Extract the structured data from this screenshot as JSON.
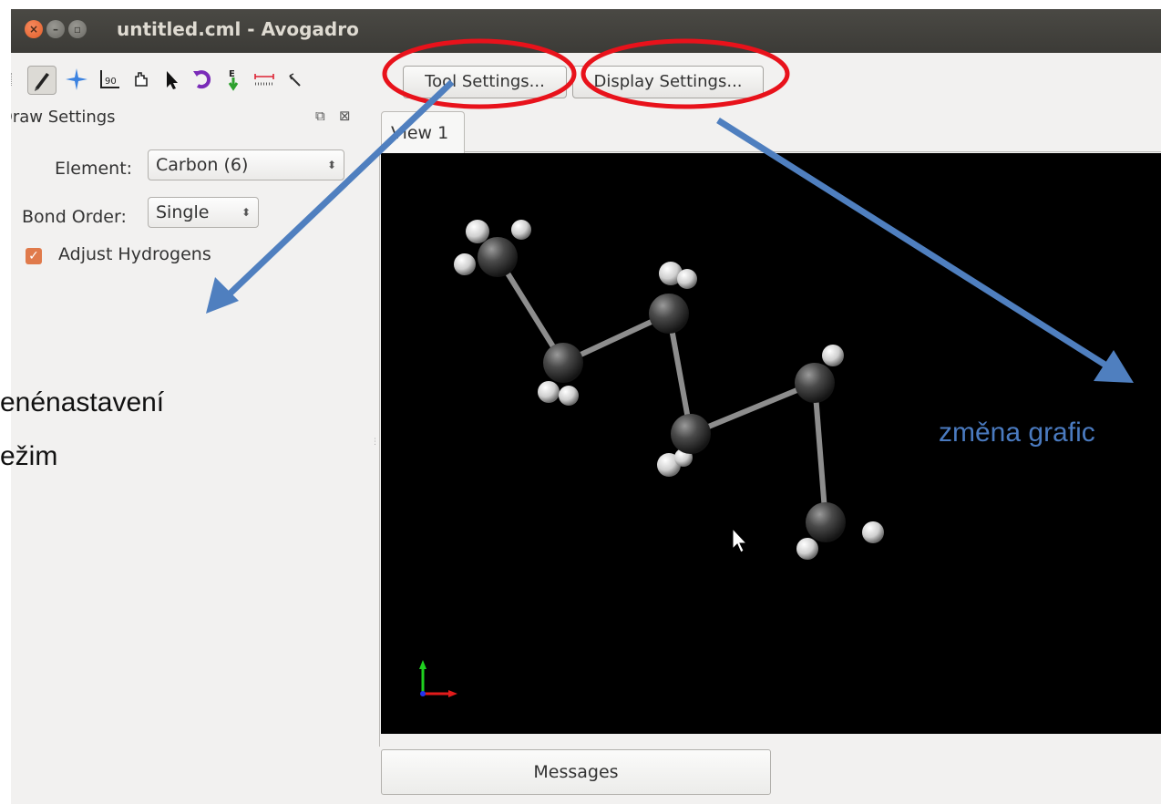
{
  "window": {
    "title": "untitled.cml - Avogadro"
  },
  "titlebar_icons": [
    "close-icon",
    "minimize-icon",
    "maximize-icon"
  ],
  "toolbar": {
    "tools": [
      "draw-icon",
      "navigate-icon",
      "measure-icon",
      "manipulate-icon",
      "select-icon",
      "rotate-icon",
      "optimize-icon",
      "align-icon",
      "bond-centric-icon"
    ],
    "tool_settings_label": "Tool Settings...",
    "display_settings_label": "Display Settings..."
  },
  "dock": {
    "title": "Draw Settings",
    "element_label": "Element:",
    "element_value": "Carbon (6)",
    "bond_order_label": "Bond Order:",
    "bond_order_value": "Single",
    "adjust_hydrogens_label": "Adjust Hydrogens",
    "adjust_hydrogens_checked": true
  },
  "view": {
    "tab_label": "View 1"
  },
  "messages_label": "Messages",
  "annotations": {
    "left_text_line1": "enénastavení",
    "left_text_line2": "ežim",
    "right_text": "změna grafic"
  },
  "colors": {
    "annotation_red": "#e8121b",
    "arrow_blue": "#4f7fbf",
    "right_text_color": "#4a7abf",
    "accent_orange": "#e07a4b"
  }
}
